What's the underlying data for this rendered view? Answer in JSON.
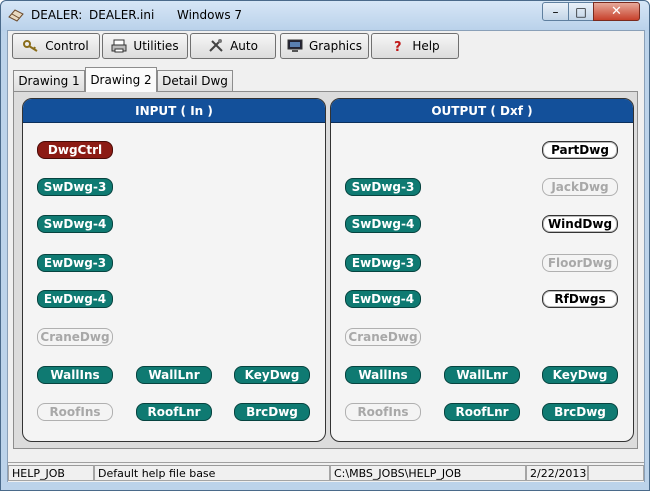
{
  "titlebar": {
    "app": "DEALER:",
    "file": "DEALER.ini",
    "os": "Windows 7",
    "minimize": "–",
    "maximize": "□",
    "close": "✕"
  },
  "toolbar": {
    "control": "Control",
    "utilities": "Utilities",
    "auto": "Auto",
    "graphics": "Graphics",
    "help": "Help"
  },
  "tabs": [
    "Drawing 1",
    "Drawing 2",
    "Detail Dwg"
  ],
  "input": {
    "title": "INPUT ( In )",
    "buttons": {
      "dwgctrl": "DwgCtrl",
      "swdwg3": "SwDwg-3",
      "swdwg4": "SwDwg-4",
      "ewdwg3": "EwDwg-3",
      "ewdwg4": "EwDwg-4",
      "cranedwg": "CraneDwg",
      "wallins": "WallIns",
      "walllnr": "WallLnr",
      "keydwg": "KeyDwg",
      "roofins": "RoofIns",
      "rooflnr": "RoofLnr",
      "brcdwg": "BrcDwg"
    }
  },
  "output": {
    "title": "OUTPUT ( Dxf )",
    "buttons": {
      "partdwg": "PartDwg",
      "swdwg3": "SwDwg-3",
      "jackdwg": "JackDwg",
      "swdwg4": "SwDwg-4",
      "winddwg": "WindDwg",
      "ewdwg3": "EwDwg-3",
      "floordwg": "FloorDwg",
      "ewdwg4": "EwDwg-4",
      "rfdwgs": "RfDwgs",
      "cranedwg": "CraneDwg",
      "wallins": "WallIns",
      "walllnr": "WallLnr",
      "keydwg": "KeyDwg",
      "roofins": "RoofIns",
      "rooflnr": "RoofLnr",
      "brcdwg": "BrcDwg"
    }
  },
  "status": {
    "job": "HELP_JOB",
    "description": "Default help file base",
    "path": "C:\\MBS_JOBS\\HELP_JOB",
    "date": "2/22/2013",
    "extra": ""
  },
  "colors": {
    "header": "#13509a",
    "teal_button": "#0f7a72",
    "red_button": "#8c1b14",
    "close_button": "#c7412b"
  }
}
